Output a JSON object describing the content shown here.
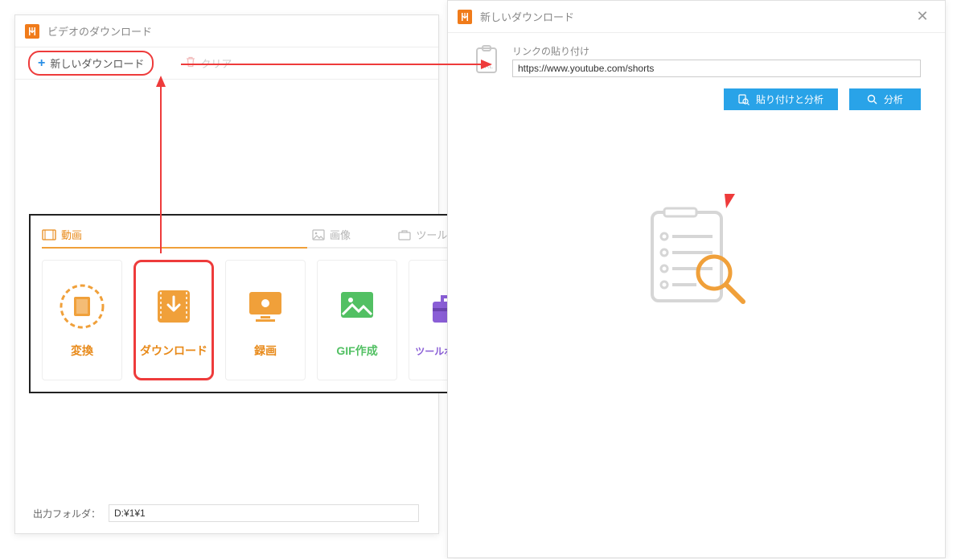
{
  "left_window": {
    "title": "ビデオのダウンロード",
    "new_download": "新しいダウンロード",
    "clear": "クリア",
    "output_folder_label": "出力フォルダ：",
    "output_folder_value": "D:¥1¥1"
  },
  "tool_panel": {
    "tabs": {
      "video": "動画",
      "image": "画像",
      "toolbox": "ツールボックス"
    },
    "tools": [
      {
        "label": "変換",
        "color": "orange"
      },
      {
        "label": "ダウンロード",
        "color": "orange"
      },
      {
        "label": "録画",
        "color": "orange"
      },
      {
        "label": "GIF作成",
        "color": "green"
      },
      {
        "label": "ツールボックス",
        "color": "purple"
      }
    ]
  },
  "right_window": {
    "title": "新しいダウンロード",
    "paste_label": "リンクの貼り付け",
    "url_value": "https://www.youtube.com/shorts",
    "paste_analyze_btn": "貼り付けと分析",
    "analyze_btn": "分析"
  }
}
